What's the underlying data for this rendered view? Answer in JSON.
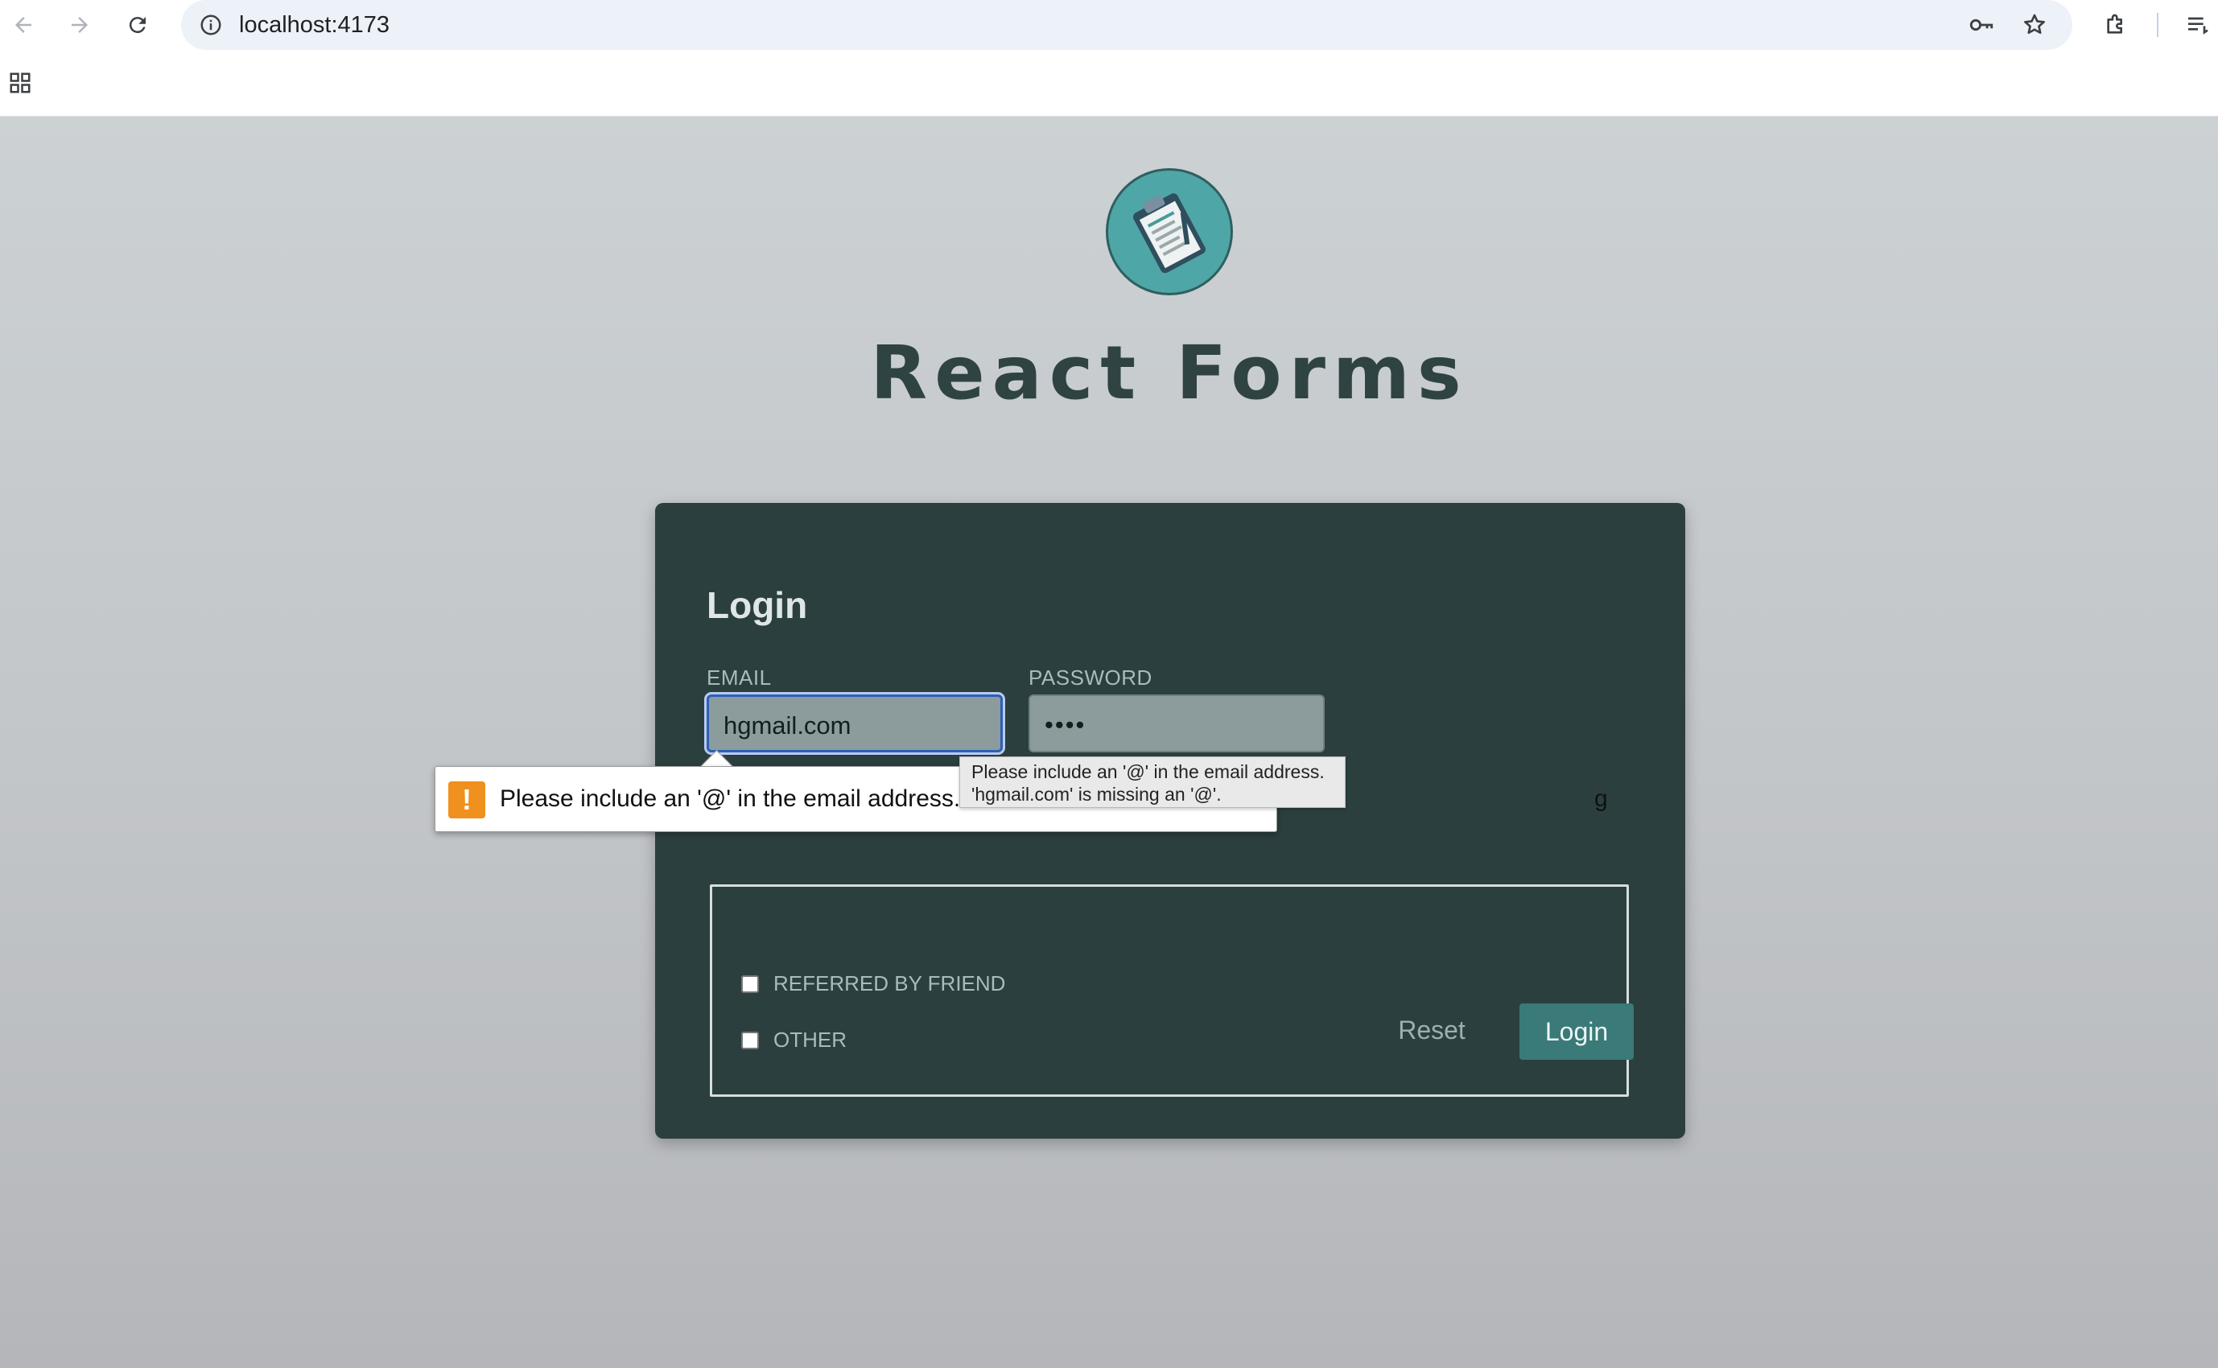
{
  "browser": {
    "url": "localhost:4173"
  },
  "page": {
    "app_title": "React Forms",
    "logo_icon": "clipboard-icon"
  },
  "form": {
    "title": "Login",
    "email_label": "EMAIL",
    "email_value": "hgmail.com",
    "password_label": "PASSWORD",
    "password_value": "••••",
    "checkboxes": [
      {
        "label": "REFERRED BY FRIEND",
        "checked": false
      },
      {
        "label": "OTHER",
        "checked": false
      }
    ],
    "reset_label": "Reset",
    "login_label": "Login"
  },
  "validation": {
    "bubble_text": "Please include an '@' in the email address. 'h",
    "bubble_tail": "g",
    "tooltip_line1": "Please include an '@' in the email address.",
    "tooltip_line2": "'hgmail.com' is missing an '@'.",
    "icon": "warning-icon"
  },
  "colors": {
    "card": "#2b3f3f",
    "accent": "#3a7a78",
    "title": "#2f4342",
    "warning": "#f0901e"
  }
}
